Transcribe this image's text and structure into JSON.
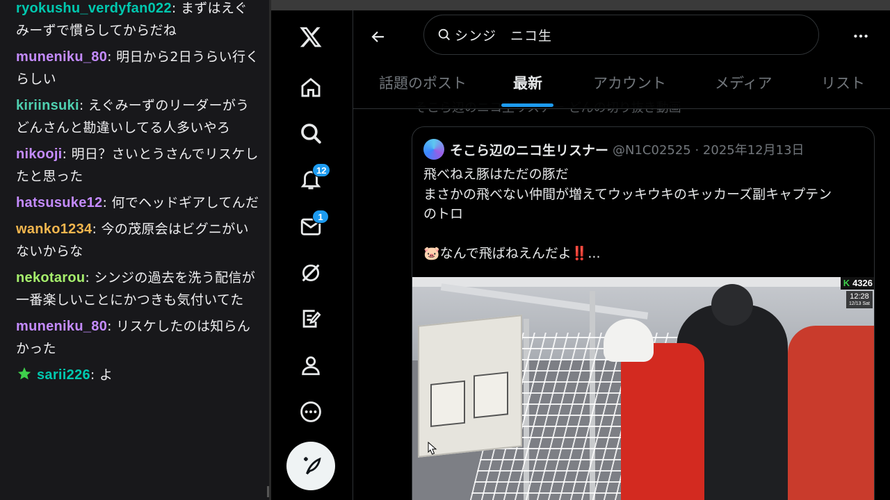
{
  "chat": {
    "messages": [
      {
        "user": "ryokushu_verdyfan022",
        "color": "#00c8af",
        "text": "まずはえぐみーずで慣らしてからだね"
      },
      {
        "user": "muneniku_80",
        "color": "#c48bff",
        "text": "明日から2日うらい行くらしい"
      },
      {
        "user": "kiriinsuki",
        "color": "#4fd0b0",
        "text": "えぐみーずのリーダーがうどんさんと勘違いしてる人多いやろ"
      },
      {
        "user": "nikooji",
        "color": "#c48bff",
        "text": "明日？さいとうさんでリスケしたと思った"
      },
      {
        "user": "hatsusuke12",
        "color": "#c48bff",
        "text": "何でヘッドギアしてんだ"
      },
      {
        "user": "wanko1234",
        "color": "#f2b64e",
        "text": "今の茂原会はビグニがいないからな"
      },
      {
        "user": "nekotarou",
        "color": "#a6ef6c",
        "text": "シンジの過去を洗う配信が一番楽しいことにかつきも気付いてた"
      },
      {
        "user": "muneniku_80",
        "color": "#c48bff",
        "text": "リスケしたのは知らんかった"
      },
      {
        "user": "sarii226",
        "color": "#00c8af",
        "text": "よ",
        "badge": "star-icon"
      }
    ]
  },
  "nav": {
    "notifications_count": "12",
    "messages_count": "1"
  },
  "search": {
    "query": "シンジ　ニコ生"
  },
  "tabs": [
    "話題のポスト",
    "最新",
    "アカウント",
    "メディア",
    "リスト"
  ],
  "active_tab": "最新",
  "post": {
    "faded_text": "そこら辺のニコ生リスナー どんの切り抜き動画"
  },
  "quote": {
    "name": "そこら辺のニコ生リスナー",
    "handle_date": "@N1C02525 · 2025年12月13日",
    "lines": [
      "飛べねえ豚はただの豚だ",
      "まさかの飛べない仲間が増えてウッキウキのキッカーズ副キャプテン",
      "のトロ",
      "",
      "🐷なんで飛ばねえんだよ‼️..."
    ],
    "media": {
      "k_badge": "K",
      "viewer_count": "4326",
      "time": "12:28",
      "date": "12/13 Sat"
    }
  },
  "colors": {
    "accent": "#1d9bf0",
    "chat_bg": "#18181b",
    "x_bg": "#000000",
    "secondary_text": "#71767b"
  }
}
